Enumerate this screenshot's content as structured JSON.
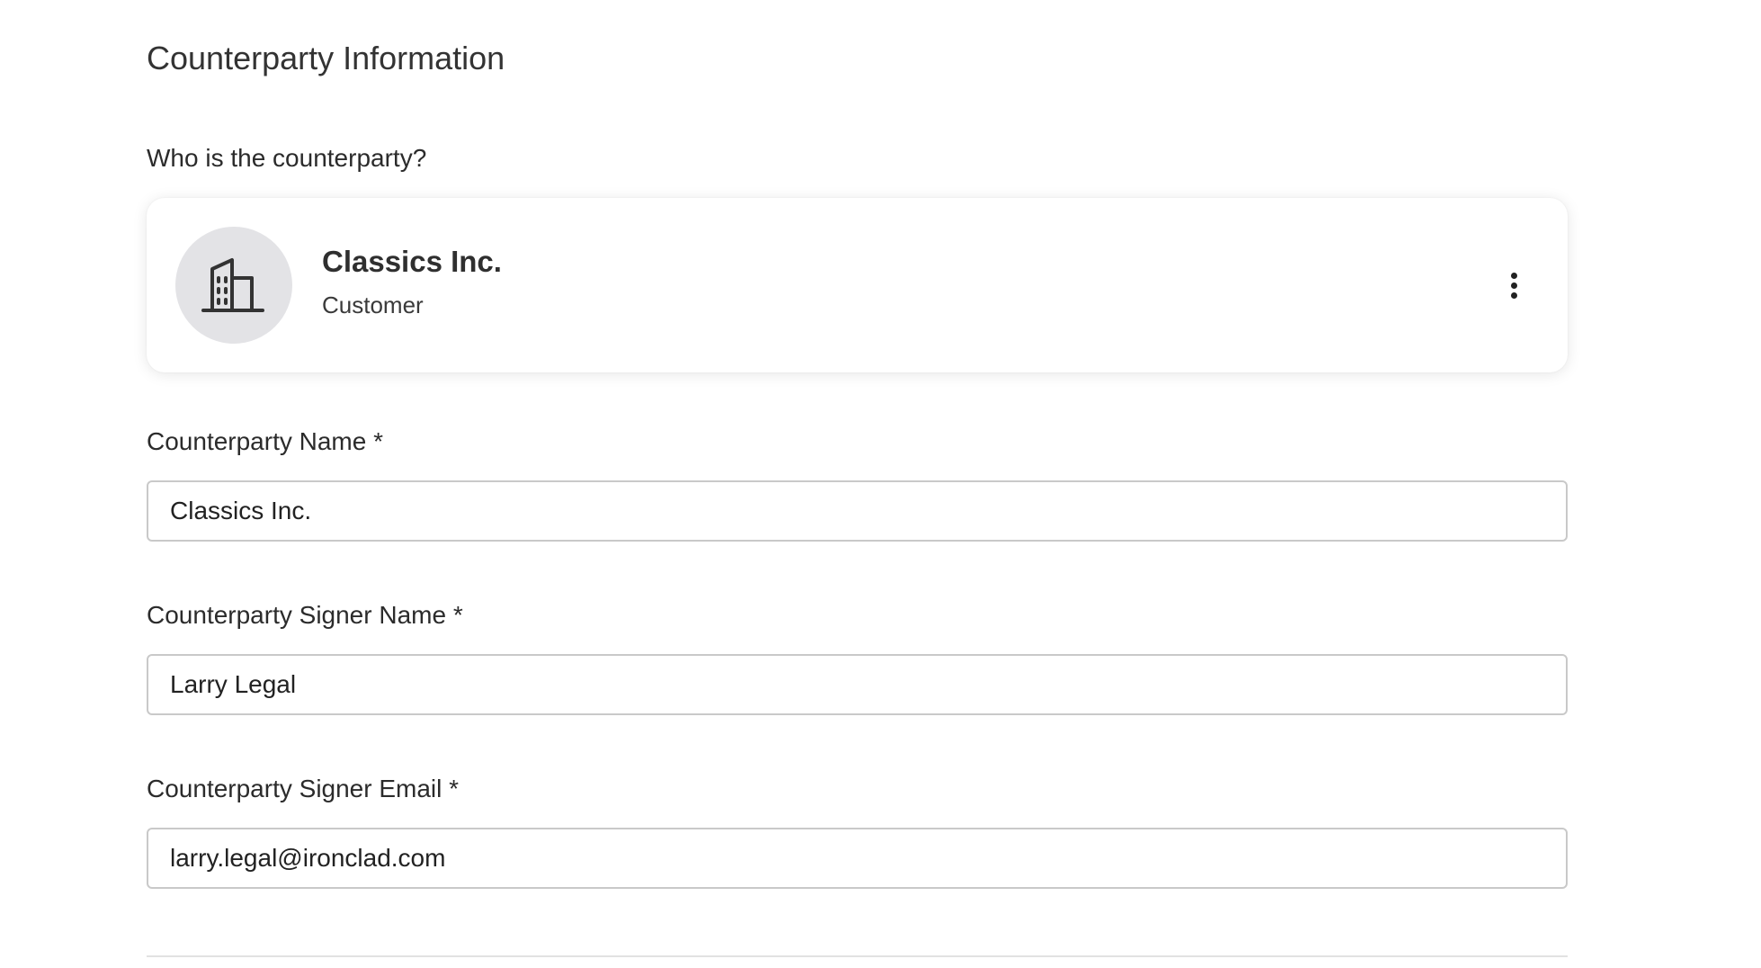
{
  "section": {
    "title": "Counterparty Information",
    "question": "Who is the counterparty?"
  },
  "counterparty_card": {
    "icon": "building-icon",
    "name": "Classics Inc.",
    "role": "Customer",
    "menu_icon": "kebab-menu-icon"
  },
  "fields": {
    "name": {
      "label": "Counterparty Name *",
      "value": "Classics Inc."
    },
    "signer_name": {
      "label": "Counterparty Signer Name *",
      "value": "Larry Legal"
    },
    "signer_email": {
      "label": "Counterparty Signer Email *",
      "value": "larry.legal@ironclad.com"
    }
  },
  "colors": {
    "avatar_bg": "#e3e3e6",
    "input_border": "#c9c9c9",
    "text": "#2b2b2b"
  }
}
